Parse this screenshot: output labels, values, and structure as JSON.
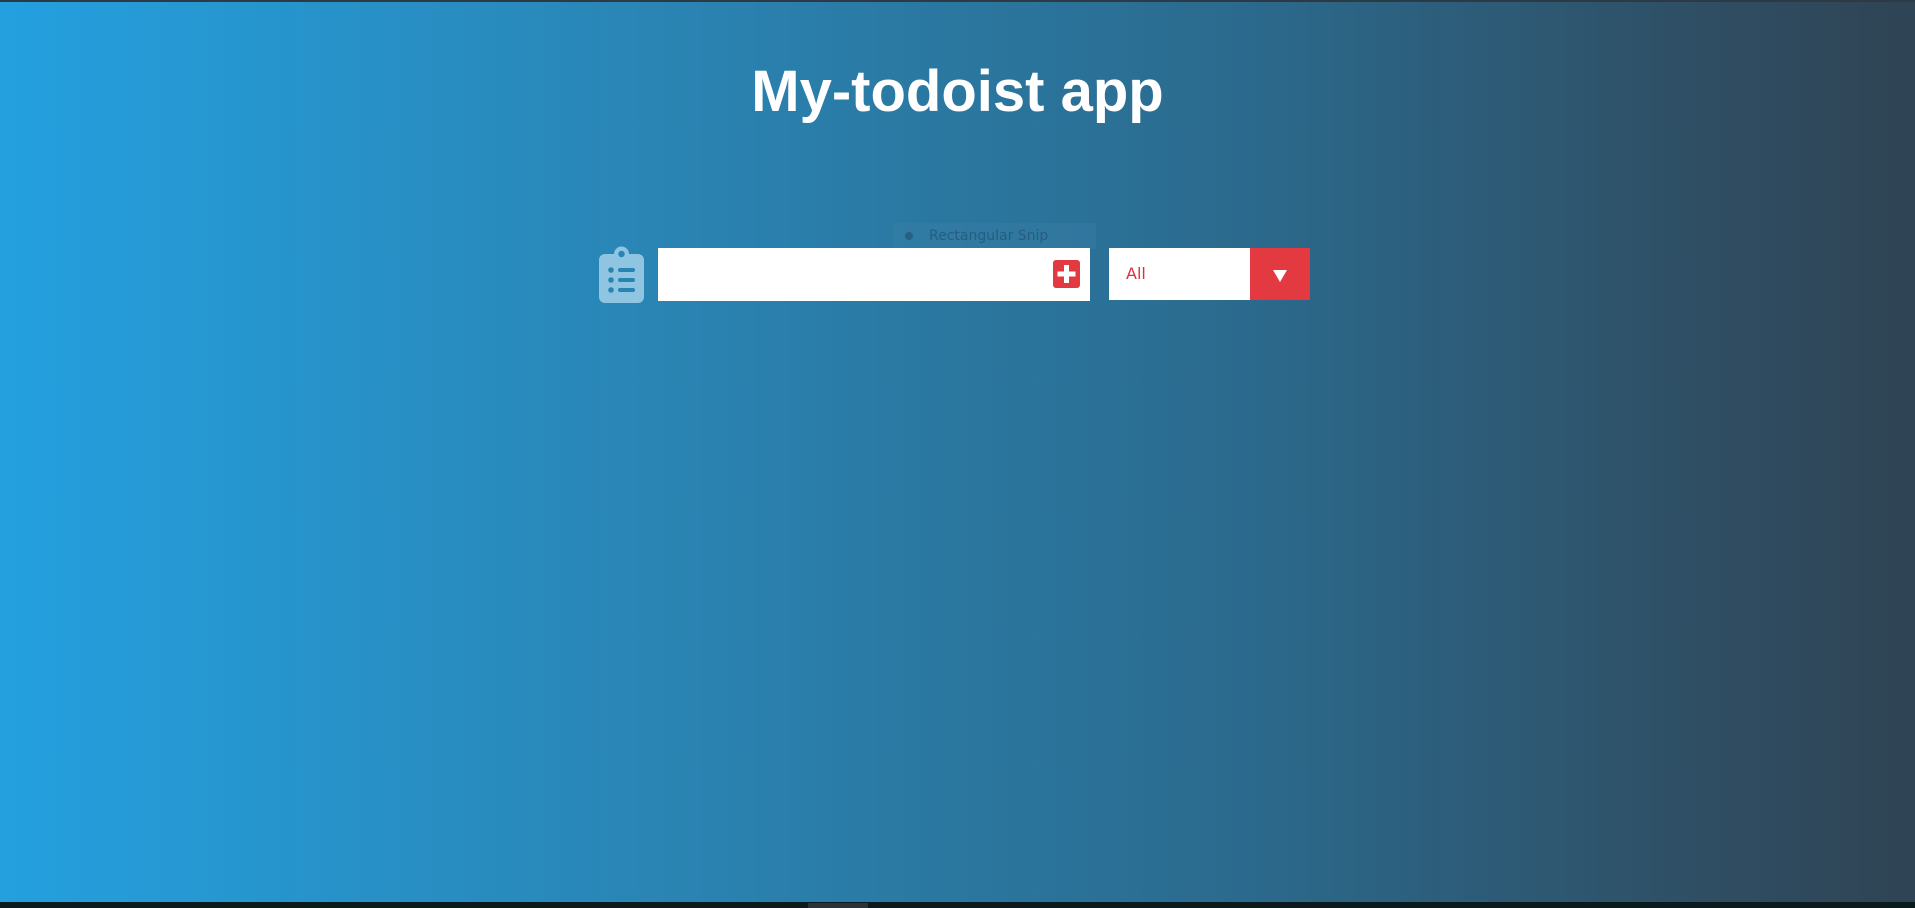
{
  "app": {
    "title": "My-todoist app"
  },
  "overlay": {
    "snip_label": "Rectangular Snip"
  },
  "todo_form": {
    "input_value": "",
    "input_placeholder": "",
    "add_icon": "plus-square-icon",
    "list_icon": "clipboard-list-icon"
  },
  "filter": {
    "selected": "All",
    "arrow_icon": "caret-down-icon"
  },
  "colors": {
    "gradient_start": "#24a0df",
    "gradient_end": "#2f4454",
    "accent_red": "#e23a40",
    "title_text": "#ffffff"
  }
}
